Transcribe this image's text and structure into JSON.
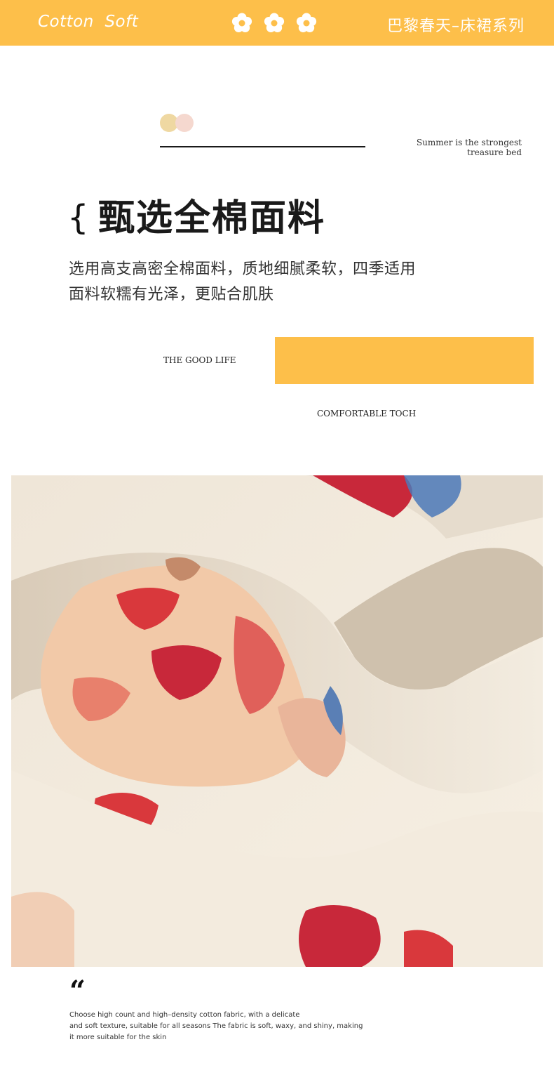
{
  "header": {
    "brand": "Cotton  Soft",
    "series": "巴黎春天–床裙系列",
    "flower_icons": [
      "flower-icon",
      "flower-icon",
      "flower-icon"
    ],
    "background_color": "#fdbf4a"
  },
  "intro": {
    "tagline_line1": "Summer is the strongest",
    "tagline_line2": "treasure bed",
    "dot_colors": [
      "#efd8a2",
      "#f5d8cf"
    ]
  },
  "section": {
    "brace": "{",
    "title": "甄选全棉面料",
    "desc_line1": "选用高支高密全棉面料，质地细腻柔软，四季适用",
    "desc_line2": "面料软糯有光泽，更贴合肌肤"
  },
  "labels": {
    "good_life": "THE GOOD LIFE",
    "comfortable": "COMFORTABLE TOCH",
    "accent_color": "#fdbf4a"
  },
  "photo": {
    "icon": "fabric-photo"
  },
  "quote": {
    "mark": "“",
    "line1": "Choose high count and high–density cotton fabric, with a delicate",
    "line2": "and soft texture, suitable for all seasons The fabric is soft, waxy, and shiny, making",
    "line3": "it more suitable for the skin"
  }
}
